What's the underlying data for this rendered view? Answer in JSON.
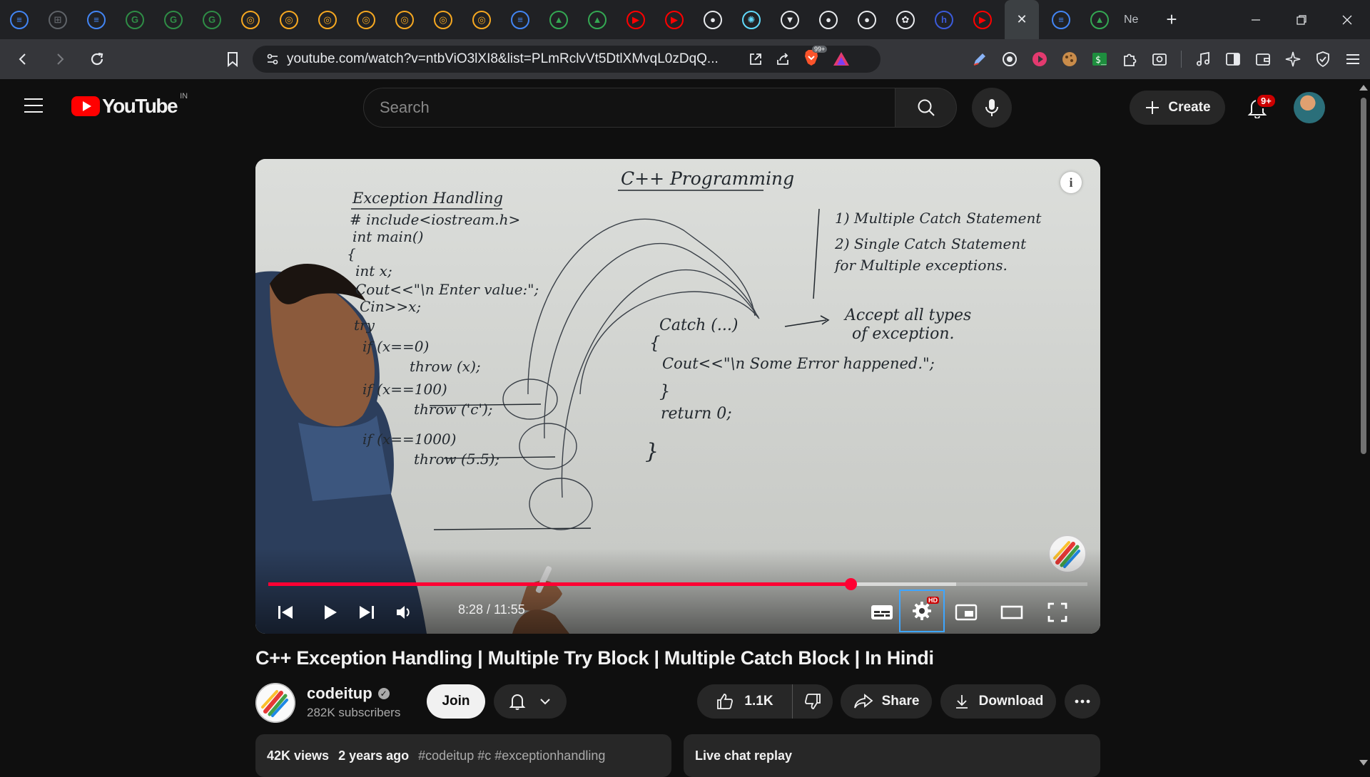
{
  "browser": {
    "tabs": [
      {
        "icon": "docs-icon",
        "color": "#4285f4"
      },
      {
        "icon": "grid-icon",
        "color": "#5f6368"
      },
      {
        "icon": "docs-icon",
        "color": "#4285f4"
      },
      {
        "icon": "gfg-icon",
        "color": "#2f8d46"
      },
      {
        "icon": "gfg-icon",
        "color": "#2f8d46"
      },
      {
        "icon": "gfg-icon",
        "color": "#2f8d46"
      },
      {
        "icon": "course-icon",
        "color": "#f6a821"
      },
      {
        "icon": "course-icon",
        "color": "#f6a821"
      },
      {
        "icon": "course-icon",
        "color": "#f6a821"
      },
      {
        "icon": "course-icon",
        "color": "#f6a821"
      },
      {
        "icon": "course-icon",
        "color": "#f6a821"
      },
      {
        "icon": "course-icon",
        "color": "#f6a821"
      },
      {
        "icon": "course-icon",
        "color": "#f6a821"
      },
      {
        "icon": "docs-icon",
        "color": "#4285f4"
      },
      {
        "icon": "drive-icon",
        "color": "#34a853"
      },
      {
        "icon": "drive-icon",
        "color": "#34a853"
      },
      {
        "icon": "youtube-icon",
        "color": "#ff0000"
      },
      {
        "icon": "youtube-icon",
        "color": "#ff0000"
      },
      {
        "icon": "github-icon",
        "color": "#e8eaed"
      },
      {
        "icon": "react-icon",
        "color": "#61dafb"
      },
      {
        "icon": "vercel-icon",
        "color": "#e8eaed"
      },
      {
        "icon": "github-icon",
        "color": "#e8eaed"
      },
      {
        "icon": "github-icon",
        "color": "#e8eaed"
      },
      {
        "icon": "openai-icon",
        "color": "#e8eaed"
      },
      {
        "icon": "hashnode-icon",
        "color": "#3b5bdb"
      },
      {
        "icon": "youtube-icon",
        "color": "#ff0000"
      }
    ],
    "active_tab_close": "✕",
    "after_tabs": [
      {
        "icon": "docs-icon",
        "color": "#4285f4"
      },
      {
        "icon": "drive-icon",
        "color": "#34a853"
      }
    ],
    "last_tab_text": "Ne",
    "new_tab": "+",
    "url": "youtube.com/watch?v=ntbViO3lXI8&list=PLmRclvVt5DtlXMvqL0zDqQ...",
    "brave_badge": "99+"
  },
  "youtube": {
    "country": "IN",
    "logo_text": "YouTube",
    "search_placeholder": "Search",
    "create_label": "Create",
    "notifications_badge": "9+"
  },
  "video": {
    "current_time": "8:28",
    "duration": "11:55",
    "time_display": "8:28 / 11:55",
    "progress_fraction": 0.711,
    "buffered_fraction": 0.84,
    "quality_badge": "HD",
    "board": {
      "header": "C++ Programming",
      "title": "Exception Handling",
      "code_lines": [
        "# include<iostream.h>",
        "int main()",
        "{",
        " int x;",
        " Cout<<\"\\n Enter value:\";",
        " Cin>>x;",
        " try",
        "   if (x==0)",
        "     throw (x);",
        "   if (x==100)",
        "     throw ('c');",
        "   if (x==1000)",
        "     throw (5.5);"
      ],
      "notes": [
        "1) Multiple Catch Statement",
        "2) Single Catch Statement",
        "   for Multiple exceptions."
      ],
      "catch_line": "Catch (...)",
      "catch_note_1": "Accept all types",
      "catch_note_2": "of exception.",
      "brace_open": "{",
      "cout_line": "Cout<<\"\\n Some Error happened.\";",
      "brace_close": "}",
      "return_line": "return 0;",
      "final_brace": "}"
    }
  },
  "meta": {
    "title": "C++ Exception Handling | Multiple Try Block | Multiple Catch Block | In Hindi",
    "channel": "codeitup",
    "subscribers": "282K subscribers",
    "join_label": "Join",
    "likes": "1.1K",
    "share_label": "Share",
    "download_label": "Download",
    "views": "42K views",
    "age": "2 years ago",
    "tags": "#codeitup #c #exceptionhandling",
    "live_chat_label": "Live chat replay"
  },
  "colors": {
    "accent": "#ff0033",
    "brand": "#ff0000",
    "page_bg": "#0f0f0f",
    "chip_bg": "#272727",
    "focus": "#3ea6ff"
  }
}
